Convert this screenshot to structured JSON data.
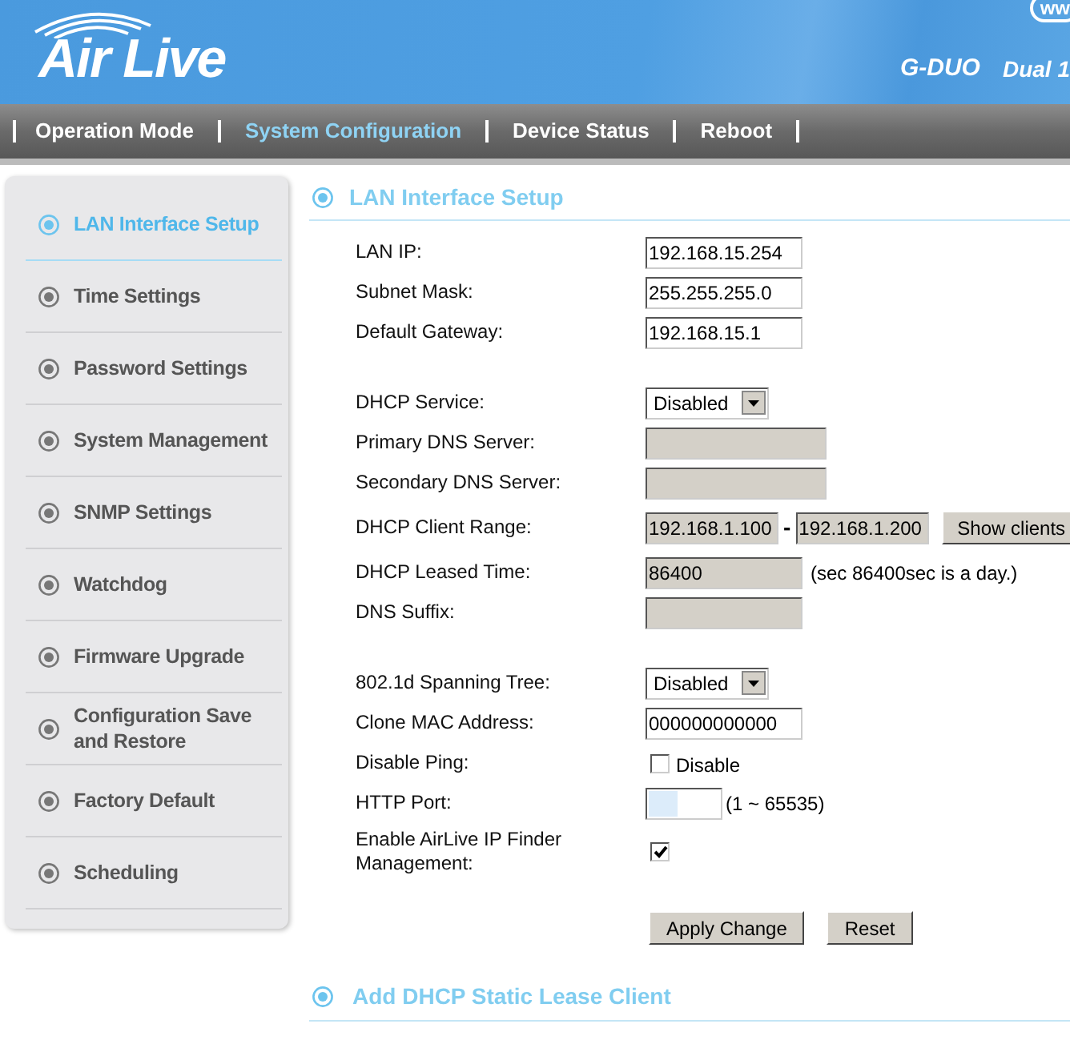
{
  "header": {
    "logo": "Air Live",
    "badge": "ww",
    "model": "G-DUO",
    "tagline": "Dual 1"
  },
  "nav": [
    {
      "label": "Operation Mode",
      "selected": false
    },
    {
      "label": "System Configuration",
      "selected": true
    },
    {
      "label": "Device Status",
      "selected": false
    },
    {
      "label": "Reboot",
      "selected": false
    }
  ],
  "sidebar": {
    "items": [
      {
        "label": "LAN Interface Setup",
        "selected": true
      },
      {
        "label": "Time Settings",
        "selected": false
      },
      {
        "label": "Password Settings",
        "selected": false
      },
      {
        "label": "System Management",
        "selected": false
      },
      {
        "label": "SNMP Settings",
        "selected": false
      },
      {
        "label": "Watchdog",
        "selected": false
      },
      {
        "label": "Firmware Upgrade",
        "selected": false
      },
      {
        "label": "Configuration Save and Restore",
        "selected": false
      },
      {
        "label": "Factory Default",
        "selected": false
      },
      {
        "label": "Scheduling",
        "selected": false
      }
    ]
  },
  "main": {
    "title": "LAN Interface Setup",
    "groups": [
      [
        {
          "kind": "text",
          "label": "LAN IP:",
          "value": "192.168.15.254",
          "disabled": false
        },
        {
          "kind": "text",
          "label": "Subnet Mask:",
          "value": "255.255.255.0",
          "disabled": false
        },
        {
          "kind": "text",
          "label": "Default Gateway:",
          "value": "192.168.15.1",
          "disabled": false
        }
      ],
      [
        {
          "kind": "select",
          "label": "DHCP Service:",
          "value": "Disabled"
        },
        {
          "kind": "text",
          "label": "Primary DNS Server:",
          "disabled": true,
          "wide": true
        },
        {
          "kind": "text",
          "label": "Secondary DNS Server:",
          "disabled": true,
          "wide": true
        },
        {
          "kind": "range",
          "label": "DHCP Client Range:",
          "from": "192.168.1.100",
          "separator": "-",
          "to": "192.168.1.200",
          "button": "Show clients"
        },
        {
          "kind": "text",
          "label": "DHCP Leased Time:",
          "value": "86400",
          "disabled": true,
          "note": "(sec 86400sec is a day.)"
        },
        {
          "kind": "text",
          "label": "DNS Suffix:",
          "disabled": true
        }
      ],
      [
        {
          "kind": "select",
          "label": "802.1d Spanning Tree:",
          "value": "Disabled"
        },
        {
          "kind": "text",
          "label": "Clone MAC Address:",
          "value": "000000000000",
          "disabled": false
        },
        {
          "kind": "checkbox",
          "label": "Disable Ping:",
          "checked": false,
          "caption": "Disable"
        },
        {
          "kind": "port",
          "label": "HTTP Port:",
          "note": "(1 ~ 65535)"
        },
        {
          "kind": "checkbox",
          "label": "Enable AirLive IP Finder Management:",
          "checked": true
        }
      ]
    ],
    "buttons": [
      "Apply Change",
      "Reset"
    ],
    "next_section": "Add DHCP Static Lease Client"
  }
}
